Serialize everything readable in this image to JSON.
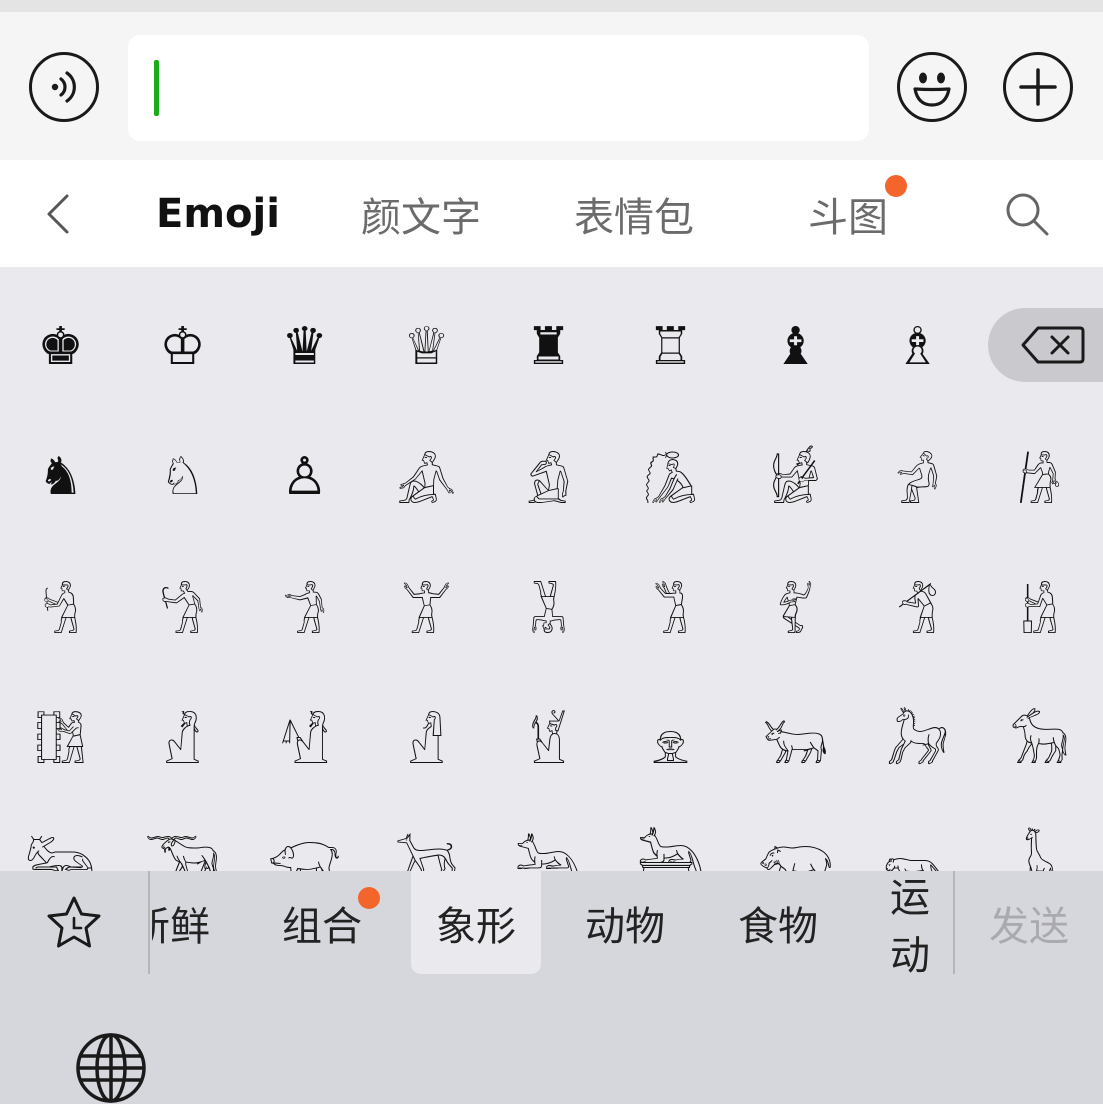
{
  "tabs": {
    "emoji": "Emoji",
    "kaomoji": "颜文字",
    "stickers": "表情包",
    "fight": "斗图"
  },
  "grid": {
    "row1": [
      "♚",
      "♔",
      "♛",
      "♕",
      "♜",
      "♖",
      "♝",
      "♗"
    ],
    "row2": [
      "♞",
      "♘",
      "♙",
      "𓀉",
      "𓀁",
      "𓀈",
      "𓀎",
      "𓀕",
      "𓀙"
    ],
    "row3": [
      "𓀜",
      "𓀝",
      "𓀞",
      "𓀠",
      "𓀡",
      "𓀢",
      "𓀤",
      "𓀦",
      "𓀧"
    ],
    "row4": [
      "𓀨",
      "𓀯",
      "𓀰",
      "𓀭",
      "𓁵",
      "𓁷",
      "𓃒",
      "𓃗",
      "𓃘"
    ],
    "row5": [
      "𓃛",
      "𓃝",
      "𓃟",
      "𓃡",
      "𓃢",
      "𓃣",
      "𓃯",
      "𓃮",
      "𓃱"
    ]
  },
  "categories": {
    "fresh": "新鲜",
    "combo": "组合",
    "pictograph": "象形",
    "animals": "动物",
    "food": "食物",
    "sports": "运动"
  },
  "send_label": "发送",
  "icons": {
    "voice": "voice-icon",
    "emoji": "smiley-icon",
    "plus": "plus-icon",
    "back": "chevron-left-icon",
    "search": "search-icon",
    "delete": "backspace-icon",
    "favorites": "star-icon",
    "globe": "globe-icon"
  },
  "colors": {
    "caret": "#1aad19",
    "badge": "#f3652b"
  }
}
